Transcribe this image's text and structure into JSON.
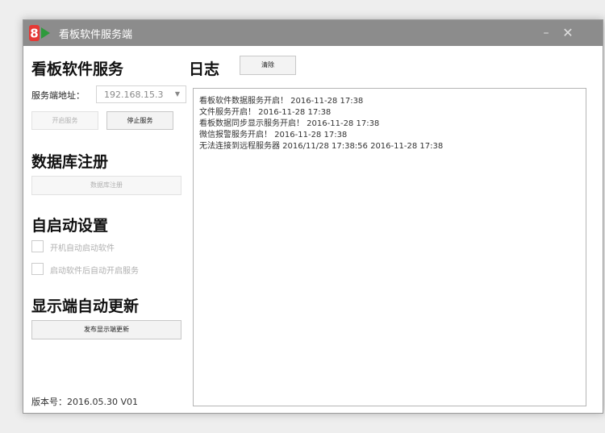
{
  "window": {
    "title": "看板软件服务端",
    "logo_text": "8"
  },
  "left": {
    "service_heading": "看板软件服务",
    "server_address_label": "服务端地址：",
    "server_address_value": "192.168.15.3",
    "start_service_label": "开启服务",
    "stop_service_label": "停止服务",
    "db_heading": "数据库注册",
    "db_register_label": "数据库注册",
    "autostart_heading": "自启动设置",
    "autostart_options": [
      "开机自动启动软件",
      "启动软件后自动开启服务"
    ],
    "update_heading": "显示端自动更新",
    "publish_update_label": "发布显示端更新",
    "version_text": "版本号：2016.05.30 V01"
  },
  "log": {
    "heading": "日志",
    "clear_label": "清除",
    "lines": [
      "看板软件数据服务开启！ 2016-11-28 17:38",
      "文件服务开启！ 2016-11-28 17:38",
      "看板数据同步显示服务开启！ 2016-11-28 17:38",
      "微信报警服务开启！ 2016-11-28 17:38",
      "无法连接到远程服务器 2016/11/28 17:38:56 2016-11-28 17:38"
    ]
  },
  "colors": {
    "titlebar": "#8c8c8c",
    "logo_red": "#e53935",
    "logo_green": "#2e9a3c"
  }
}
